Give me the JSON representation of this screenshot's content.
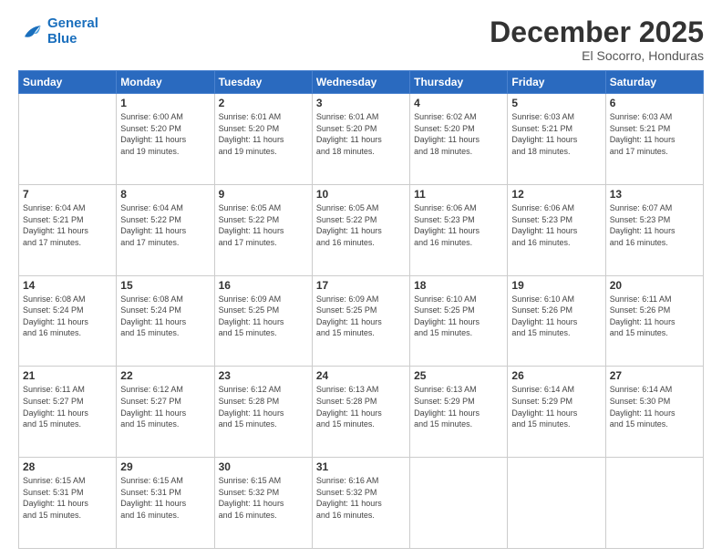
{
  "logo": {
    "line1": "General",
    "line2": "Blue"
  },
  "title": "December 2025",
  "subtitle": "El Socorro, Honduras",
  "days_header": [
    "Sunday",
    "Monday",
    "Tuesday",
    "Wednesday",
    "Thursday",
    "Friday",
    "Saturday"
  ],
  "weeks": [
    [
      {
        "day": "",
        "info": ""
      },
      {
        "day": "1",
        "info": "Sunrise: 6:00 AM\nSunset: 5:20 PM\nDaylight: 11 hours\nand 19 minutes."
      },
      {
        "day": "2",
        "info": "Sunrise: 6:01 AM\nSunset: 5:20 PM\nDaylight: 11 hours\nand 19 minutes."
      },
      {
        "day": "3",
        "info": "Sunrise: 6:01 AM\nSunset: 5:20 PM\nDaylight: 11 hours\nand 18 minutes."
      },
      {
        "day": "4",
        "info": "Sunrise: 6:02 AM\nSunset: 5:20 PM\nDaylight: 11 hours\nand 18 minutes."
      },
      {
        "day": "5",
        "info": "Sunrise: 6:03 AM\nSunset: 5:21 PM\nDaylight: 11 hours\nand 18 minutes."
      },
      {
        "day": "6",
        "info": "Sunrise: 6:03 AM\nSunset: 5:21 PM\nDaylight: 11 hours\nand 17 minutes."
      }
    ],
    [
      {
        "day": "7",
        "info": "Sunrise: 6:04 AM\nSunset: 5:21 PM\nDaylight: 11 hours\nand 17 minutes."
      },
      {
        "day": "8",
        "info": "Sunrise: 6:04 AM\nSunset: 5:22 PM\nDaylight: 11 hours\nand 17 minutes."
      },
      {
        "day": "9",
        "info": "Sunrise: 6:05 AM\nSunset: 5:22 PM\nDaylight: 11 hours\nand 17 minutes."
      },
      {
        "day": "10",
        "info": "Sunrise: 6:05 AM\nSunset: 5:22 PM\nDaylight: 11 hours\nand 16 minutes."
      },
      {
        "day": "11",
        "info": "Sunrise: 6:06 AM\nSunset: 5:23 PM\nDaylight: 11 hours\nand 16 minutes."
      },
      {
        "day": "12",
        "info": "Sunrise: 6:06 AM\nSunset: 5:23 PM\nDaylight: 11 hours\nand 16 minutes."
      },
      {
        "day": "13",
        "info": "Sunrise: 6:07 AM\nSunset: 5:23 PM\nDaylight: 11 hours\nand 16 minutes."
      }
    ],
    [
      {
        "day": "14",
        "info": "Sunrise: 6:08 AM\nSunset: 5:24 PM\nDaylight: 11 hours\nand 16 minutes."
      },
      {
        "day": "15",
        "info": "Sunrise: 6:08 AM\nSunset: 5:24 PM\nDaylight: 11 hours\nand 15 minutes."
      },
      {
        "day": "16",
        "info": "Sunrise: 6:09 AM\nSunset: 5:25 PM\nDaylight: 11 hours\nand 15 minutes."
      },
      {
        "day": "17",
        "info": "Sunrise: 6:09 AM\nSunset: 5:25 PM\nDaylight: 11 hours\nand 15 minutes."
      },
      {
        "day": "18",
        "info": "Sunrise: 6:10 AM\nSunset: 5:25 PM\nDaylight: 11 hours\nand 15 minutes."
      },
      {
        "day": "19",
        "info": "Sunrise: 6:10 AM\nSunset: 5:26 PM\nDaylight: 11 hours\nand 15 minutes."
      },
      {
        "day": "20",
        "info": "Sunrise: 6:11 AM\nSunset: 5:26 PM\nDaylight: 11 hours\nand 15 minutes."
      }
    ],
    [
      {
        "day": "21",
        "info": "Sunrise: 6:11 AM\nSunset: 5:27 PM\nDaylight: 11 hours\nand 15 minutes."
      },
      {
        "day": "22",
        "info": "Sunrise: 6:12 AM\nSunset: 5:27 PM\nDaylight: 11 hours\nand 15 minutes."
      },
      {
        "day": "23",
        "info": "Sunrise: 6:12 AM\nSunset: 5:28 PM\nDaylight: 11 hours\nand 15 minutes."
      },
      {
        "day": "24",
        "info": "Sunrise: 6:13 AM\nSunset: 5:28 PM\nDaylight: 11 hours\nand 15 minutes."
      },
      {
        "day": "25",
        "info": "Sunrise: 6:13 AM\nSunset: 5:29 PM\nDaylight: 11 hours\nand 15 minutes."
      },
      {
        "day": "26",
        "info": "Sunrise: 6:14 AM\nSunset: 5:29 PM\nDaylight: 11 hours\nand 15 minutes."
      },
      {
        "day": "27",
        "info": "Sunrise: 6:14 AM\nSunset: 5:30 PM\nDaylight: 11 hours\nand 15 minutes."
      }
    ],
    [
      {
        "day": "28",
        "info": "Sunrise: 6:15 AM\nSunset: 5:31 PM\nDaylight: 11 hours\nand 15 minutes."
      },
      {
        "day": "29",
        "info": "Sunrise: 6:15 AM\nSunset: 5:31 PM\nDaylight: 11 hours\nand 16 minutes."
      },
      {
        "day": "30",
        "info": "Sunrise: 6:15 AM\nSunset: 5:32 PM\nDaylight: 11 hours\nand 16 minutes."
      },
      {
        "day": "31",
        "info": "Sunrise: 6:16 AM\nSunset: 5:32 PM\nDaylight: 11 hours\nand 16 minutes."
      },
      {
        "day": "",
        "info": ""
      },
      {
        "day": "",
        "info": ""
      },
      {
        "day": "",
        "info": ""
      }
    ]
  ]
}
